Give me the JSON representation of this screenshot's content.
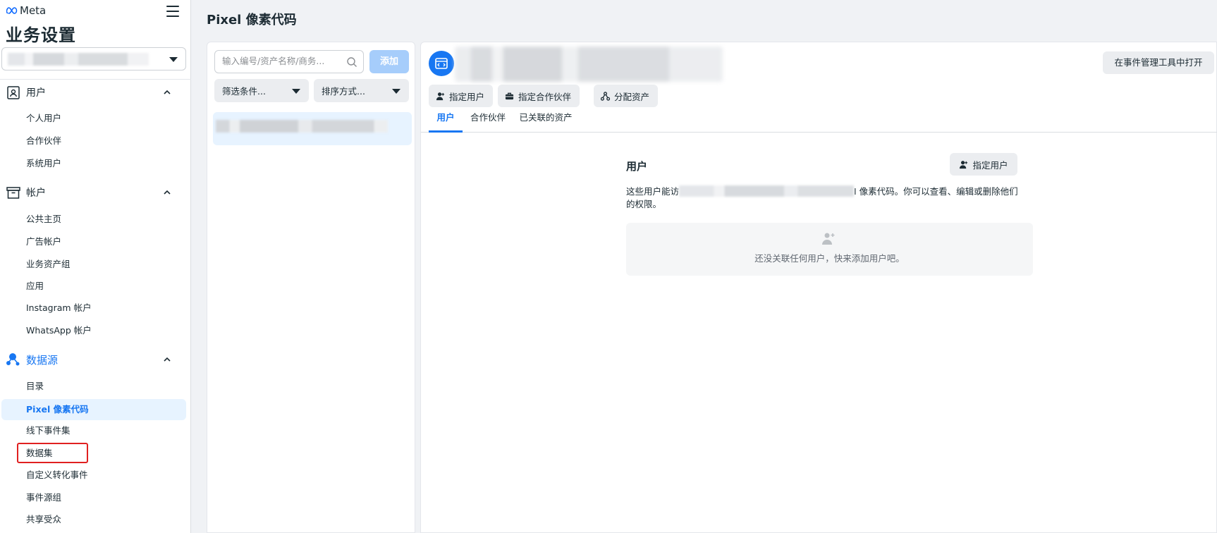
{
  "brand": {
    "logo_text": "Meta"
  },
  "app_title": "业务设置",
  "sidebar": {
    "sections": [
      {
        "label": "用户",
        "icon": "user-badge-icon",
        "items": [
          "个人用户",
          "合作伙伴",
          "系统用户"
        ]
      },
      {
        "label": "帐户",
        "icon": "archive-box-icon",
        "items": [
          "公共主页",
          "广告帐户",
          "业务资产组",
          "应用",
          "Instagram 帐户",
          "WhatsApp 帐户"
        ]
      },
      {
        "label": "数据源",
        "icon": "data-sources-icon",
        "items": [
          "目录",
          "Pixel 像素代码",
          "线下事件集",
          "数据集",
          "自定义转化事件",
          "事件源组",
          "共享受众"
        ]
      }
    ],
    "active_item": "Pixel 像素代码",
    "highlighted_item": "数据集"
  },
  "page_title": "Pixel 像素代码",
  "list_panel": {
    "search_placeholder": "输入编号/资产名称/商务...",
    "add_label": "添加",
    "filter_label": "筛选条件...",
    "sort_label": "排序方式..."
  },
  "detail": {
    "open_in_events_manager": "在事件管理工具中打开",
    "actions": [
      "指定用户",
      "指定合作伙伴",
      "分配资产"
    ],
    "tabs": [
      "用户",
      "合作伙伴",
      "已关联的资产"
    ],
    "active_tab": "用户",
    "users_heading": "用户",
    "assign_user_label": "指定用户",
    "description_prefix": "这些用户能访",
    "description_suffix": "I 像素代码。你可以查看、编辑或删除他们的权限。",
    "empty_text": "还没关联任何用户，快来添加用户吧。"
  },
  "colors": {
    "accent": "#1877f2",
    "highlight_border": "#e02020",
    "active_bg": "#e7f3ff"
  }
}
